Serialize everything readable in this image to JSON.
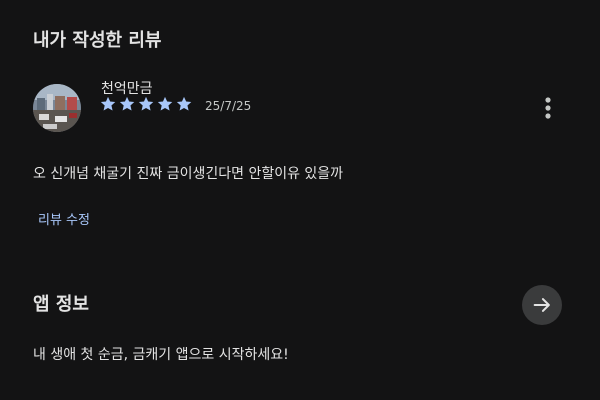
{
  "review_section": {
    "title": "내가 작성한 리뷰",
    "reviewer_name": "천억만금",
    "rating": 5,
    "date": "25/7/25",
    "text": "오 신개념 채굴기 진짜 금이생긴다면 안할이유 있을까",
    "edit_label": "리뷰 수정",
    "more_icon": "more-vert-icon"
  },
  "app_info": {
    "title": "앱 정보",
    "description": "내 생애 첫 순금, 금캐기 앱으로 시작하세요!",
    "arrow_icon": "arrow-forward-icon"
  },
  "colors": {
    "background": "#131314",
    "star": "#a8c7fa",
    "link": "#a8c7fa"
  }
}
